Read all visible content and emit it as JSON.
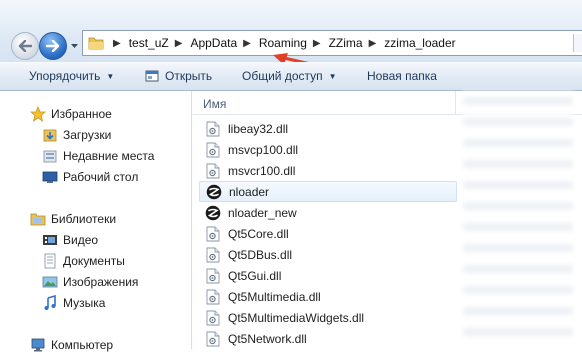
{
  "address_bar": {
    "crumbs": [
      "test_uZ",
      "AppData",
      "Roaming",
      "ZZima",
      "zzima_loader"
    ]
  },
  "toolbar": {
    "organize_label": "Упорядочить",
    "open_label": "Открыть",
    "share_label": "Общий доступ",
    "new_folder_label": "Новая папка"
  },
  "nav_pane": {
    "favorites": {
      "label": "Избранное",
      "items": [
        "Загрузки",
        "Недавние места",
        "Рабочий стол"
      ]
    },
    "libraries": {
      "label": "Библиотеки",
      "items": [
        "Видео",
        "Документы",
        "Изображения",
        "Музыка"
      ]
    },
    "computer": {
      "label": "Компьютер"
    }
  },
  "file_list": {
    "column_name": "Имя",
    "files": [
      {
        "name": "libeay32.dll",
        "icon": "dll-file-icon"
      },
      {
        "name": "msvcp100.dll",
        "icon": "dll-file-icon"
      },
      {
        "name": "msvcr100.dll",
        "icon": "dll-file-icon"
      },
      {
        "name": "nloader",
        "icon": "zzima-app-icon"
      },
      {
        "name": "nloader_new",
        "icon": "zzima-app-icon"
      },
      {
        "name": "Qt5Core.dll",
        "icon": "dll-file-icon"
      },
      {
        "name": "Qt5DBus.dll",
        "icon": "dll-file-icon"
      },
      {
        "name": "Qt5Gui.dll",
        "icon": "dll-file-icon"
      },
      {
        "name": "Qt5Multimedia.dll",
        "icon": "dll-file-icon"
      },
      {
        "name": "Qt5MultimediaWidgets.dll",
        "icon": "dll-file-icon"
      },
      {
        "name": "Qt5Network.dll",
        "icon": "dll-file-icon"
      }
    ],
    "hovered_index": 3
  },
  "colors": {
    "annotation_arrow": "#e0402a",
    "toolbar_text": "#1e395b"
  }
}
